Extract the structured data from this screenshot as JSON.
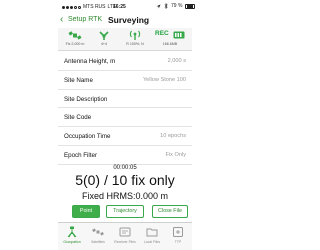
{
  "status_bar": {
    "carrier": "MTS RUS",
    "network": "LTE",
    "time": "16:25",
    "battery": "79 %"
  },
  "nav": {
    "back_label": "Setup RTK",
    "title": "Surveying"
  },
  "toolbar": {
    "items": [
      {
        "label": "Fix 2,000 m",
        "icon": "satellite-icon"
      },
      {
        "label": "4+4",
        "icon": "satellite-count-icon"
      },
      {
        "label": "R 100%; N",
        "icon": "radio-link-icon"
      },
      {
        "label": "166.6MB",
        "icon": "storage-icon"
      }
    ],
    "rec_label": "REC"
  },
  "rows": [
    {
      "label": "Antenna Height, m",
      "value": "2,000 s"
    },
    {
      "label": "Site Name",
      "value": "Yellow Stone 100"
    },
    {
      "label": "Site Description",
      "value": ""
    },
    {
      "label": "Site Code",
      "value": ""
    },
    {
      "label": "Occupation Time",
      "value": "10 epochs"
    },
    {
      "label": "Epoch Filter",
      "value": "Fix Only"
    }
  ],
  "timer": "00:00:05",
  "big_status": "5(0) / 10 fix only",
  "hrms": "Fixed HRMS:0.000 m",
  "buttons": {
    "point": "Point",
    "trajectory": "Trajectory",
    "close_file": "Close File"
  },
  "tabs": [
    {
      "label": "Occupation",
      "icon": "occupation-icon",
      "active": true
    },
    {
      "label": "Satellites",
      "icon": "satellites-icon",
      "active": false
    },
    {
      "label": "Receiver Files",
      "icon": "receiver-files-icon",
      "active": false
    },
    {
      "label": "Local Files",
      "icon": "local-files-icon",
      "active": false
    },
    {
      "label": "TTP",
      "icon": "ttp-icon",
      "active": false
    }
  ],
  "colors": {
    "accent": "#2f8a2f",
    "rec": "#1fa340",
    "button_fill": "#3fae4a"
  }
}
